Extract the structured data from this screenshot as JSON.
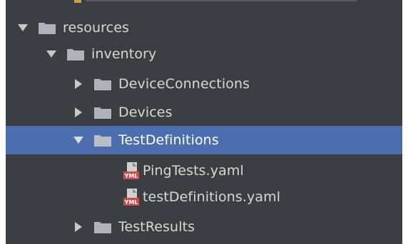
{
  "tree": {
    "items": [
      {
        "label": "resources",
        "expanded": true,
        "type": "folder",
        "selected": false
      },
      {
        "label": "inventory",
        "expanded": true,
        "type": "folder",
        "selected": false
      },
      {
        "label": "DeviceConnections",
        "expanded": false,
        "type": "folder",
        "selected": false
      },
      {
        "label": "Devices",
        "expanded": false,
        "type": "folder",
        "selected": false
      },
      {
        "label": "TestDefinitions",
        "expanded": true,
        "type": "folder",
        "selected": true
      },
      {
        "label": "PingTests.yaml",
        "type": "file",
        "selected": false
      },
      {
        "label": "testDefinitions.yaml",
        "type": "file",
        "selected": false
      },
      {
        "label": "TestResults",
        "expanded": false,
        "type": "folder",
        "selected": false
      }
    ]
  },
  "icons": {
    "folder": "folder-icon",
    "yaml_file": "yaml-file-icon",
    "expanded": "triangle-down-icon",
    "collapsed": "triangle-right-icon",
    "yaml_badge": "YML"
  },
  "colors": {
    "panel_bg": "#3c3f41",
    "selection_bg": "#4b6eaf",
    "text": "#d8d8d8",
    "folder": "#aeb3b9",
    "yaml_badge": "#c94c4c"
  }
}
